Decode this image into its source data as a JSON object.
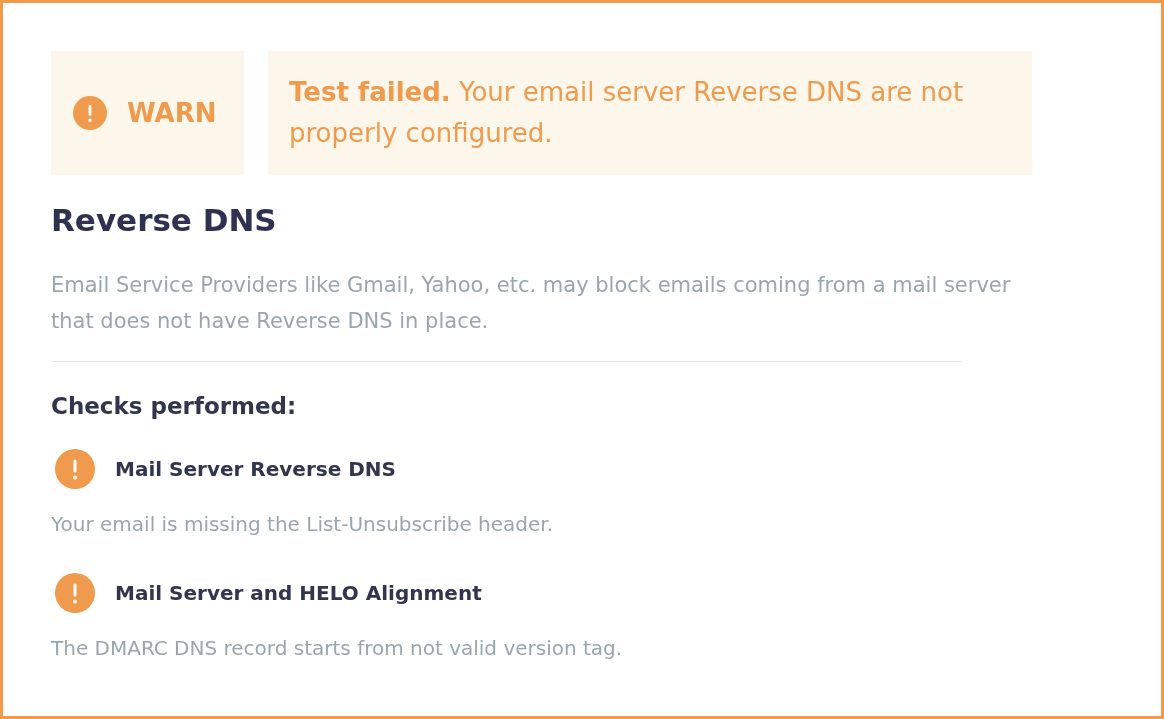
{
  "result": {
    "kind": "warn",
    "label": "WARN",
    "message": "**Test failed.** Your email server Reverse DNS are not properly configured."
  },
  "title": "Reverse DNS",
  "description": "Email Service Providers like Gmail, Yahoo, etc. may block emails coming from a mail server that does not have Reverse DNS in place.",
  "checks_heading": "Checks performed:",
  "checks": [
    {
      "kind": "warn",
      "title": "Mail Server Reverse DNS",
      "description": "Your email is missing the List-Unsubscribe header."
    },
    {
      "kind": "warn",
      "title": "Mail Server and HELO Alignment",
      "description": "The DMARC DNS record starts from not valid version tag."
    }
  ]
}
